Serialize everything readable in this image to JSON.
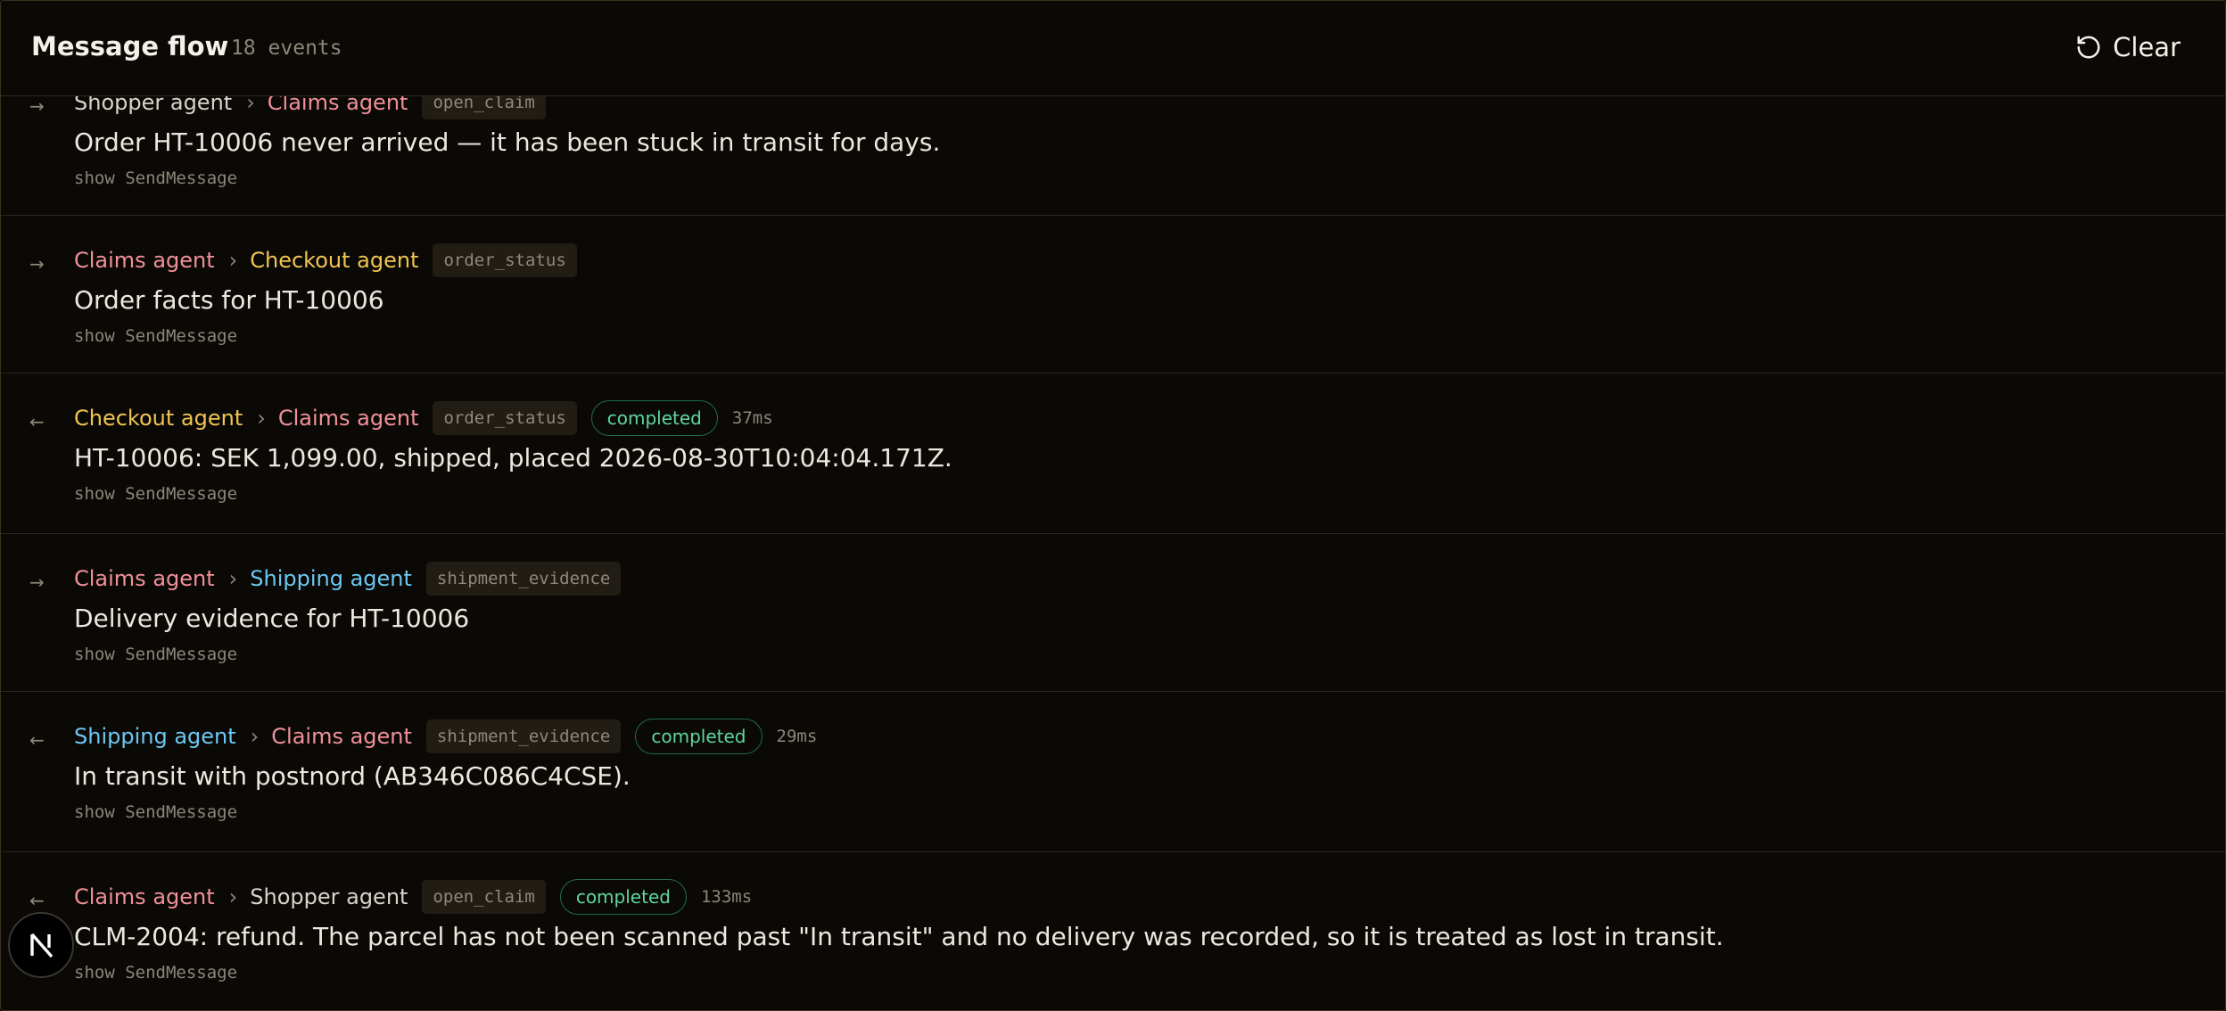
{
  "header": {
    "title": "Message flow",
    "count": "18 events",
    "clear_label": "Clear"
  },
  "show_label": "show SendMessage",
  "events": [
    {
      "direction": "→",
      "from": "Shopper agent",
      "to": "Claims agent",
      "tool": "open_claim",
      "status": "",
      "duration": "",
      "text": "Order HT-10006 never arrived — it has been stuck in transit for days."
    },
    {
      "direction": "→",
      "from": "Claims agent",
      "to": "Checkout agent",
      "tool": "order_status",
      "status": "",
      "duration": "",
      "text": "Order facts for HT-10006"
    },
    {
      "direction": "←",
      "from": "Checkout agent",
      "to": "Claims agent",
      "tool": "order_status",
      "status": "completed",
      "duration": "37ms",
      "text": "HT-10006: SEK 1,099.00, shipped, placed 2026-08-30T10:04:04.171Z."
    },
    {
      "direction": "→",
      "from": "Claims agent",
      "to": "Shipping agent",
      "tool": "shipment_evidence",
      "status": "",
      "duration": "",
      "text": "Delivery evidence for HT-10006"
    },
    {
      "direction": "←",
      "from": "Shipping agent",
      "to": "Claims agent",
      "tool": "shipment_evidence",
      "status": "completed",
      "duration": "29ms",
      "text": "In transit with postnord (AB346C086C4CSE)."
    },
    {
      "direction": "←",
      "from": "Claims agent",
      "to": "Shopper agent",
      "tool": "open_claim",
      "status": "completed",
      "duration": "133ms",
      "text": "CLM-2004: refund. The parcel has not been scanned past \"In transit\" and no delivery was recorded, so it is treated as lost in transit."
    }
  ],
  "icons": {
    "clear": "rotate-ccw-icon",
    "logo": "nextjs-logo-icon"
  },
  "colors": {
    "claims_agent": "#f0909a",
    "checkout_agent": "#f0c453",
    "shipping_agent": "#6cc7f2",
    "shopper_agent": "#d8d4cc",
    "status_completed": "#5fd6a0"
  }
}
